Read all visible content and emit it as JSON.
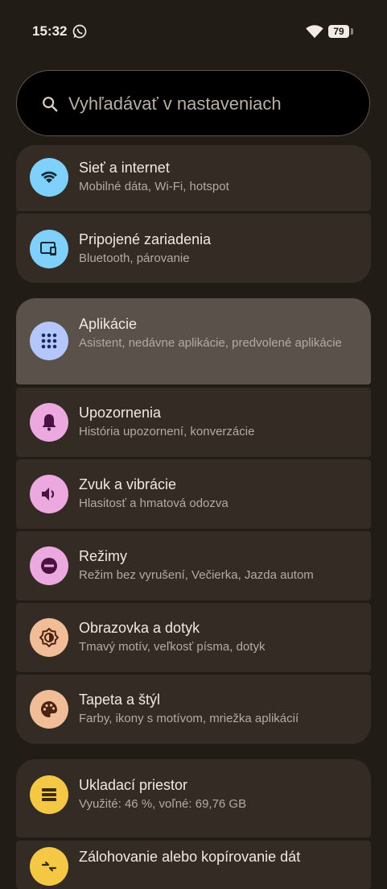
{
  "status": {
    "time": "15:32",
    "battery": "79"
  },
  "search": {
    "placeholder": "Vyhľadávať v nastaveniach"
  },
  "items": [
    {
      "title": "Sieť a internet",
      "subtitle": "Mobilné dáta, Wi‑Fi, hotspot",
      "icon": "wifi-icon",
      "color": "#7fd0fb"
    },
    {
      "title": "Pripojené zariadenia",
      "subtitle": "Bluetooth, párovanie",
      "icon": "devices-icon",
      "color": "#7fd0fb"
    },
    {
      "title": "Aplikácie",
      "subtitle": "Asistent, nedávne aplikácie, predvolené aplikácie",
      "icon": "apps-icon",
      "color": "#b4c6fc"
    },
    {
      "title": "Upozornenia",
      "subtitle": "História upozornení, konverzácie",
      "icon": "bell-icon",
      "color": "#eba9df"
    },
    {
      "title": "Zvuk a vibrácie",
      "subtitle": "Hlasitosť a hmatová odozva",
      "icon": "speaker-icon",
      "color": "#eba9df"
    },
    {
      "title": "Režimy",
      "subtitle": "Režim bez vyrušení, Večierka, Jazda autom",
      "icon": "minus-circle-icon",
      "color": "#eba9df"
    },
    {
      "title": "Obrazovka a dotyk",
      "subtitle": "Tmavý motív, veľkosť písma, dotyk",
      "icon": "brightness-icon",
      "color": "#f1bd98"
    },
    {
      "title": "Tapeta a štýl",
      "subtitle": "Farby, ikony s motívom, mriežka aplikácií",
      "icon": "palette-icon",
      "color": "#f1bd98"
    },
    {
      "title": "Ukladací priestor",
      "subtitle": "Využité: 46 %, voľné: 69,76 GB",
      "icon": "storage-icon",
      "color": "#f4c744"
    },
    {
      "title": "Zálohovanie alebo kopírovanie dát",
      "subtitle": "",
      "icon": "backup-icon",
      "color": "#f4c744"
    }
  ]
}
